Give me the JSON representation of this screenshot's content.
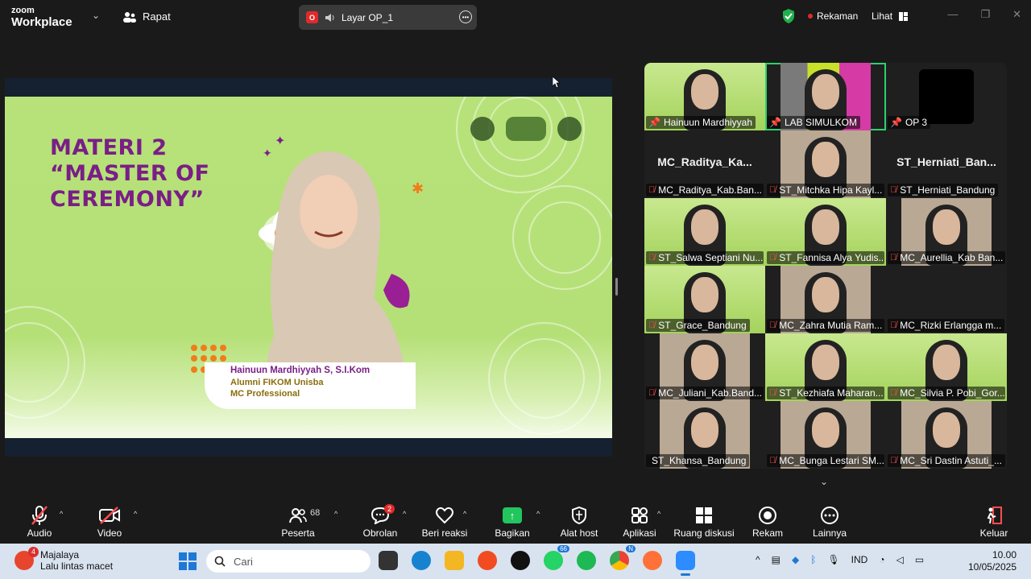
{
  "topbar": {
    "brand_top": "zoom",
    "brand_bottom": "Workplace",
    "meeting_label": "Rapat",
    "screen_source_badge": "O",
    "screen_source": "Layar OP_1",
    "recording_label": "Rekaman",
    "view_label": "Lihat"
  },
  "slide": {
    "title_line1": "MATERI 2",
    "title_line2": "“MASTER OF",
    "title_line3": "CEREMONY”",
    "name": "Hainuun Mardhiyyah S, S.I.Kom",
    "role1": "Alumni FIKOM Unisba",
    "role2": "MC Professional"
  },
  "participants": [
    {
      "label": "Hainuun Mardhiyyah",
      "big": "",
      "muted": false,
      "pin": true,
      "style": "green-cam"
    },
    {
      "label": "LAB SIMULKOM",
      "big": "",
      "muted": false,
      "pin": true,
      "style": "room",
      "active": true
    },
    {
      "label": "OP 3",
      "big": "",
      "muted": false,
      "pin": true,
      "style": "dark"
    },
    {
      "label": "MC_Raditya_Kab.Ban...",
      "big": "MC_Raditya_Ka...",
      "muted": true,
      "style": "name"
    },
    {
      "label": "ST_Mitchka Hipa Kayl...",
      "big": "",
      "muted": true,
      "style": "cam"
    },
    {
      "label": "ST_Herniati_Bandung",
      "big": "ST_Herniati_Ban...",
      "muted": true,
      "style": "name"
    },
    {
      "label": "ST_Salwa Septiani Nu...",
      "big": "",
      "muted": true,
      "style": "green-cam"
    },
    {
      "label": "ST_Fannisa Alya Yudis...",
      "big": "",
      "muted": true,
      "style": "green-cam"
    },
    {
      "label": "MC_Aurellia_Kab Ban...",
      "big": "",
      "muted": true,
      "style": "cam"
    },
    {
      "label": "ST_Grace_Bandung",
      "big": "",
      "muted": true,
      "style": "green-cam"
    },
    {
      "label": "MC_Zahra Mutia Ram...",
      "big": "",
      "muted": true,
      "style": "cam"
    },
    {
      "label": "MC_Rizki Erlangga m...",
      "big": "",
      "muted": true,
      "style": "dark"
    },
    {
      "label": "MC_Juliani_Kab.Band...",
      "big": "",
      "muted": true,
      "style": "cam"
    },
    {
      "label": "ST_Kezhiafa Maharan...",
      "big": "",
      "muted": true,
      "style": "green-cam"
    },
    {
      "label": "MC_Silvia P. Pobi_Gor...",
      "big": "",
      "muted": true,
      "style": "green-cam"
    },
    {
      "label": "ST_Khansa_Bandung",
      "big": "",
      "muted": false,
      "style": "cam"
    },
    {
      "label": "MC_Bunga Lestari SM...",
      "big": "",
      "muted": true,
      "style": "cam"
    },
    {
      "label": "MC_Sri Dastin Astuti_...",
      "big": "",
      "muted": true,
      "style": "cam"
    }
  ],
  "toolbar": {
    "audio": "Audio",
    "video": "Video",
    "participants": "Peserta",
    "participants_count": "68",
    "chat": "Obrolan",
    "chat_badge": "2",
    "reactions": "Beri reaksi",
    "share": "Bagikan",
    "host_tools": "Alat host",
    "apps": "Aplikasi",
    "breakout": "Ruang diskusi",
    "record": "Rekam",
    "more": "Lainnya",
    "leave": "Keluar"
  },
  "taskbar": {
    "weather_badge": "4",
    "weather_title": "Majalaya",
    "weather_sub": "Lalu lintas macet",
    "search_placeholder": "Cari",
    "whatsapp_badge": "66",
    "chrome_badge": "N",
    "lang": "IND",
    "time": "10.00",
    "date": "10/05/2025"
  },
  "colors": {
    "accent_green": "#2bd36e",
    "record_red": "#e02a2a",
    "slide_purple": "#7a1e86",
    "slide_green": "#b7e27a"
  }
}
